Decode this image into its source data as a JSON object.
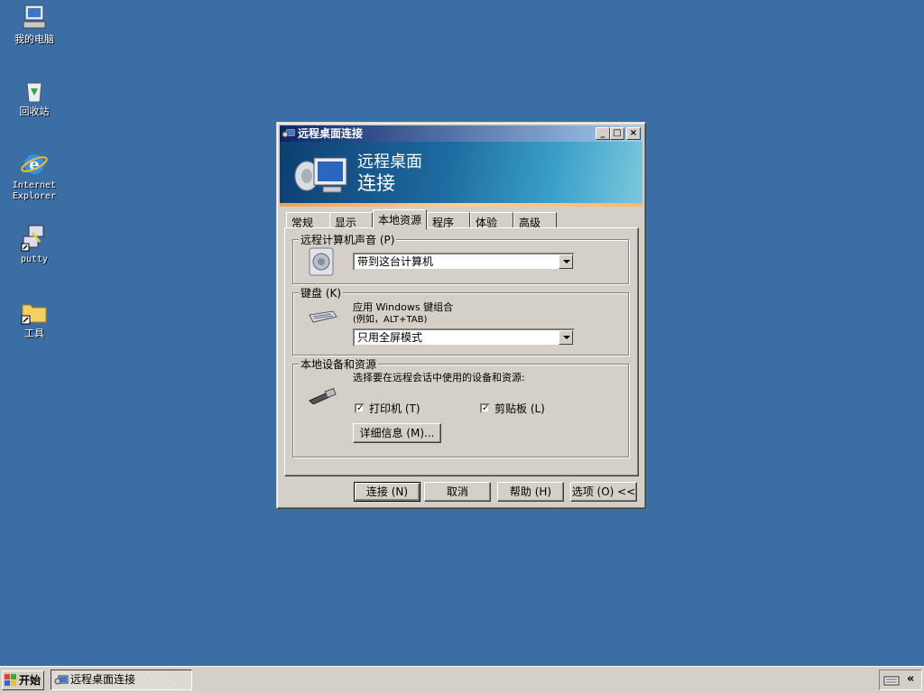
{
  "desktop": {
    "icons": [
      {
        "label": "我的电脑",
        "icon": "my-computer-icon"
      },
      {
        "label": "回收站",
        "icon": "recycle-bin-icon"
      },
      {
        "label": "Internet\nExplorer",
        "icon": "internet-explorer-icon"
      },
      {
        "label": "putty",
        "icon": "putty-icon"
      },
      {
        "label": "工具",
        "icon": "folder-shortcut-icon"
      }
    ]
  },
  "window": {
    "title": "远程桌面连接",
    "banner_line1": "远程桌面",
    "banner_line2": "连接",
    "tabs": [
      "常规",
      "显示",
      "本地资源",
      "程序",
      "体验",
      "高级"
    ],
    "active_tab": "本地资源",
    "sound_group": {
      "legend": "远程计算机声音 (P)",
      "value": "带到这台计算机"
    },
    "keyboard_group": {
      "legend": "键盘 (K)",
      "desc_line1": "应用 Windows 键组合",
      "desc_line2": "(例如，ALT+TAB)",
      "value": "只用全屏模式"
    },
    "devices_group": {
      "legend": "本地设备和资源",
      "desc": "选择要在远程会话中使用的设备和资源:",
      "printer_label": "打印机 (T)",
      "printer_checked": true,
      "clipboard_label": "剪贴板 (L)",
      "clipboard_checked": true,
      "details_button": "详细信息 (M)..."
    },
    "buttons": {
      "connect": "连接 (N)",
      "cancel": "取消",
      "help": "帮助 (H)",
      "options": "选项 (O) <<"
    }
  },
  "taskbar": {
    "start": "开始",
    "task": "远程桌面连接",
    "tray_chevron": "«"
  },
  "colors": {
    "desktop": "#3a6ea5",
    "title_active_start": "#0a246a",
    "title_active_end": "#a6caf0",
    "face": "#d4d0c8"
  }
}
